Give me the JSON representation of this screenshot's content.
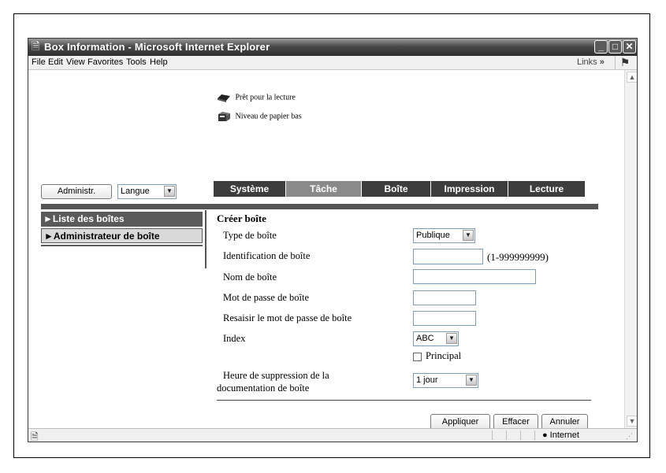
{
  "window": {
    "title": "Box Information - Microsoft Internet Explorer",
    "minimize": "_",
    "maximize": "□",
    "close": "✕"
  },
  "menu": {
    "items": [
      "File",
      "Edit",
      "View",
      "Favorites",
      "Tools",
      "Help"
    ],
    "links": "Links",
    "links_chevron": "»"
  },
  "printer_status": [
    {
      "label": "Prêt pour la lecture",
      "icon": "printer-ready-icon"
    },
    {
      "label": "Niveau de papier bas",
      "icon": "paper-low-icon"
    }
  ],
  "toolbar": {
    "admin_button": "Administr.",
    "language_select": "Langue"
  },
  "tabs": [
    {
      "label": "Système",
      "active": true
    },
    {
      "label": "Tâche",
      "active": false
    },
    {
      "label": "Boîte",
      "active": true
    },
    {
      "label": "Impression",
      "active": true
    },
    {
      "label": "Lecture",
      "active": true
    }
  ],
  "sidebar": {
    "items": [
      {
        "label": "►Liste des boîtes",
        "selected": false
      },
      {
        "label": "►Administrateur de boîte",
        "selected": true
      }
    ]
  },
  "form": {
    "title": "Créer boîte",
    "box_type_label": "Type de boîte",
    "box_type_value": "Publique",
    "box_id_label": "Identification de boîte",
    "box_id_value": "",
    "box_id_range": "(1-999999999)",
    "box_name_label": "Nom de boîte",
    "box_name_value": "",
    "password_label": "Mot de passe de boîte",
    "password_value": "",
    "password_confirm_label": "Resaisir le mot de passe de boîte",
    "password_confirm_value": "",
    "index_label": "Index",
    "index_value": "ABC",
    "principal_label": "Principal",
    "principal_checked": false,
    "deletion_time_label_line1": "Heure de suppression de la",
    "deletion_time_label_line2": "documentation de boîte",
    "deletion_time_value": "1 jour"
  },
  "actions": {
    "apply": "Appliquer",
    "clear": "Effacer",
    "cancel": "Annuler"
  },
  "statusbar": {
    "zone": "Internet"
  },
  "colors": {
    "tab_active": "#3d3d3d",
    "tab_inactive": "#8a8a8a",
    "sidebar_item": "#5a5a5a",
    "sidebar_selected": "#d9d9d9"
  }
}
